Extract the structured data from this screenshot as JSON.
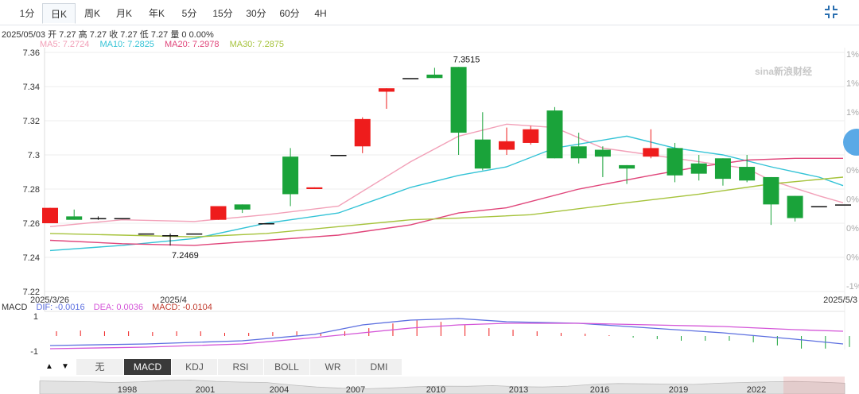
{
  "tabs": [
    "1分",
    "日K",
    "周K",
    "月K",
    "年K",
    "5分",
    "15分",
    "30分",
    "60分",
    "4H"
  ],
  "active_tab": "日K",
  "info": {
    "date": "2025/05/03",
    "open_label": "开",
    "open": "7.27",
    "high_label": "高",
    "high": "7.27",
    "close_label": "收",
    "close": "7.27",
    "low_label": "低",
    "low": "7.27",
    "volume_label": "量",
    "volume": "0",
    "change": "0.00%"
  },
  "ma_legend": [
    {
      "label": "MA5: 7.2724",
      "color": "#f2a0b8"
    },
    {
      "label": "MA10: 7.2825",
      "color": "#33c3d6"
    },
    {
      "label": "MA20: 7.2978",
      "color": "#e0457a"
    },
    {
      "label": "MA30: 7.2875",
      "color": "#a6c33c"
    }
  ],
  "watermark": "sina新浪财经",
  "macd_legend": {
    "title": "MACD",
    "dif": "DIF: -0.0016",
    "dif_color": "#5c6fe0",
    "dea": "DEA: 0.0036",
    "dea_color": "#d455d8",
    "macd": "MACD: -0.0104",
    "macd_color": "#c0392b"
  },
  "indicator_tabs": [
    "无",
    "MACD",
    "KDJ",
    "RSI",
    "BOLL",
    "WR",
    "DMI"
  ],
  "active_indicator": "MACD",
  "up_arrow": "▲",
  "down_arrow": "▼",
  "colors": {
    "up": "#ee1c1c",
    "down": "#1aa33a",
    "grid": "#eeeeee"
  },
  "chart_data": {
    "type": "candlestick",
    "x_labels": [
      "2025/3/26",
      "2025/4",
      "2025/5/3"
    ],
    "y_ticks": [
      "7.36",
      "7.34",
      "7.32",
      "7.3",
      "7.28",
      "7.26",
      "7.24",
      "7.22"
    ],
    "ylim": [
      7.22,
      7.36
    ],
    "right_ticks": [
      "1%",
      "1%",
      "1%",
      "1%",
      "0%",
      "0%",
      "0%",
      "0%",
      "-1%"
    ],
    "annotations": [
      {
        "label": "7.3515",
        "value": 7.3515,
        "candle": 17
      },
      {
        "label": "7.2469",
        "value": 7.2469,
        "candle": 5
      }
    ],
    "candles": [
      {
        "o": 7.26,
        "h": 7.269,
        "l": 7.26,
        "c": 7.269
      },
      {
        "o": 7.264,
        "h": 7.268,
        "l": 7.262,
        "c": 7.262
      },
      {
        "o": 7.263,
        "h": 7.264,
        "l": 7.262,
        "c": 7.263
      },
      {
        "o": 7.263,
        "h": 7.263,
        "l": 7.263,
        "c": 7.263
      },
      {
        "o": 7.254,
        "h": 7.254,
        "l": 7.254,
        "c": 7.254
      },
      {
        "o": 7.253,
        "h": 7.254,
        "l": 7.2469,
        "c": 7.253
      },
      {
        "o": 7.254,
        "h": 7.254,
        "l": 7.254,
        "c": 7.254
      },
      {
        "o": 7.262,
        "h": 7.27,
        "l": 7.262,
        "c": 7.27
      },
      {
        "o": 7.271,
        "h": 7.271,
        "l": 7.266,
        "c": 7.268
      },
      {
        "o": 7.26,
        "h": 7.26,
        "l": 7.26,
        "c": 7.26
      },
      {
        "o": 7.299,
        "h": 7.304,
        "l": 7.27,
        "c": 7.277
      },
      {
        "o": 7.28,
        "h": 7.281,
        "l": 7.28,
        "c": 7.281
      },
      {
        "o": 7.3,
        "h": 7.3,
        "l": 7.3,
        "c": 7.3
      },
      {
        "o": 7.305,
        "h": 7.322,
        "l": 7.301,
        "c": 7.321
      },
      {
        "o": 7.337,
        "h": 7.339,
        "l": 7.327,
        "c": 7.339
      },
      {
        "o": 7.345,
        "h": 7.345,
        "l": 7.345,
        "c": 7.345
      },
      {
        "o": 7.347,
        "h": 7.351,
        "l": 7.345,
        "c": 7.345
      },
      {
        "o": 7.3515,
        "h": 7.3515,
        "l": 7.3,
        "c": 7.313
      },
      {
        "o": 7.309,
        "h": 7.325,
        "l": 7.291,
        "c": 7.292
      },
      {
        "o": 7.303,
        "h": 7.316,
        "l": 7.3,
        "c": 7.308
      },
      {
        "o": 7.307,
        "h": 7.317,
        "l": 7.306,
        "c": 7.315
      },
      {
        "o": 7.326,
        "h": 7.328,
        "l": 7.298,
        "c": 7.298
      },
      {
        "o": 7.305,
        "h": 7.313,
        "l": 7.295,
        "c": 7.298
      },
      {
        "o": 7.303,
        "h": 7.305,
        "l": 7.287,
        "c": 7.299
      },
      {
        "o": 7.294,
        "h": 7.294,
        "l": 7.283,
        "c": 7.292
      },
      {
        "o": 7.299,
        "h": 7.315,
        "l": 7.298,
        "c": 7.304
      },
      {
        "o": 7.304,
        "h": 7.307,
        "l": 7.284,
        "c": 7.288
      },
      {
        "o": 7.295,
        "h": 7.3,
        "l": 7.285,
        "c": 7.289
      },
      {
        "o": 7.298,
        "h": 7.298,
        "l": 7.282,
        "c": 7.286
      },
      {
        "o": 7.293,
        "h": 7.3,
        "l": 7.284,
        "c": 7.285
      },
      {
        "o": 7.287,
        "h": 7.287,
        "l": 7.259,
        "c": 7.271
      },
      {
        "o": 7.276,
        "h": 7.276,
        "l": 7.261,
        "c": 7.263
      },
      {
        "o": 7.27,
        "h": 7.27,
        "l": 7.27,
        "c": 7.27
      },
      {
        "o": 7.271,
        "h": 7.271,
        "l": 7.271,
        "c": 7.271
      }
    ],
    "ma_series": [
      {
        "name": "MA5",
        "color": "#f2a0b8",
        "points": [
          [
            0,
            7.258
          ],
          [
            3,
            7.262
          ],
          [
            6,
            7.261
          ],
          [
            9,
            7.265
          ],
          [
            12,
            7.27
          ],
          [
            15,
            7.296
          ],
          [
            17,
            7.311
          ],
          [
            19,
            7.318
          ],
          [
            21,
            7.316
          ],
          [
            23,
            7.304
          ],
          [
            25,
            7.3
          ],
          [
            27,
            7.296
          ],
          [
            29,
            7.292
          ],
          [
            30,
            7.285
          ],
          [
            32,
            7.276
          ],
          [
            33,
            7.272
          ]
        ]
      },
      {
        "name": "MA10",
        "color": "#33c3d6",
        "points": [
          [
            0,
            7.244
          ],
          [
            3,
            7.247
          ],
          [
            6,
            7.251
          ],
          [
            9,
            7.26
          ],
          [
            12,
            7.266
          ],
          [
            15,
            7.281
          ],
          [
            17,
            7.288
          ],
          [
            19,
            7.293
          ],
          [
            21,
            7.304
          ],
          [
            24,
            7.311
          ],
          [
            26,
            7.304
          ],
          [
            28,
            7.3
          ],
          [
            30,
            7.293
          ],
          [
            32,
            7.287
          ],
          [
            33,
            7.282
          ]
        ]
      },
      {
        "name": "MA20",
        "color": "#e0457a",
        "points": [
          [
            0,
            7.25
          ],
          [
            3,
            7.248
          ],
          [
            6,
            7.247
          ],
          [
            9,
            7.25
          ],
          [
            12,
            7.253
          ],
          [
            15,
            7.259
          ],
          [
            17,
            7.266
          ],
          [
            19,
            7.269
          ],
          [
            22,
            7.28
          ],
          [
            25,
            7.288
          ],
          [
            27,
            7.293
          ],
          [
            29,
            7.297
          ],
          [
            31,
            7.298
          ],
          [
            33,
            7.298
          ]
        ]
      },
      {
        "name": "MA30",
        "color": "#a6c33c",
        "points": [
          [
            0,
            7.254
          ],
          [
            3,
            7.253
          ],
          [
            6,
            7.252
          ],
          [
            9,
            7.254
          ],
          [
            12,
            7.258
          ],
          [
            15,
            7.262
          ],
          [
            17,
            7.263
          ],
          [
            20,
            7.265
          ],
          [
            24,
            7.272
          ],
          [
            27,
            7.277
          ],
          [
            30,
            7.283
          ],
          [
            33,
            7.287
          ]
        ]
      }
    ],
    "macd": {
      "yticks": [
        "1",
        "-1"
      ],
      "dif_points": [
        [
          0,
          -0.6
        ],
        [
          4,
          -0.5
        ],
        [
          8,
          -0.3
        ],
        [
          11,
          0.1
        ],
        [
          13,
          0.7
        ],
        [
          15,
          1.0
        ],
        [
          17,
          1.1
        ],
        [
          19,
          0.9
        ],
        [
          22,
          0.8
        ],
        [
          25,
          0.5
        ],
        [
          28,
          0.2
        ],
        [
          31,
          -0.2
        ],
        [
          33,
          -0.5
        ]
      ],
      "dea_points": [
        [
          0,
          -0.8
        ],
        [
          4,
          -0.7
        ],
        [
          8,
          -0.5
        ],
        [
          11,
          -0.1
        ],
        [
          13,
          0.2
        ],
        [
          15,
          0.5
        ],
        [
          17,
          0.7
        ],
        [
          19,
          0.8
        ],
        [
          22,
          0.8
        ],
        [
          25,
          0.7
        ],
        [
          28,
          0.6
        ],
        [
          31,
          0.4
        ],
        [
          33,
          0.3
        ]
      ],
      "hist": [
        0.3,
        0.35,
        0.3,
        0.3,
        0.25,
        0.3,
        0.3,
        0.2,
        0.2,
        0.25,
        0.3,
        0.2,
        0.3,
        0.5,
        0.8,
        1.0,
        0.9,
        0.7,
        0.5,
        0.4,
        0.3,
        0.2,
        0.15,
        0.05,
        -0.1,
        -0.2,
        -0.3,
        -0.3,
        -0.3,
        -0.4,
        -0.6,
        -0.8,
        -0.8,
        -0.7
      ]
    },
    "overview_x_labels": [
      "1998",
      "2001",
      "2004",
      "2007",
      "2010",
      "2013",
      "2016",
      "2019",
      "2022"
    ],
    "overview_values": [
      0.75,
      0.72,
      0.7,
      0.66,
      0.7,
      0.78,
      0.8,
      0.72,
      0.68,
      0.66,
      0.52,
      0.4,
      0.33,
      0.3,
      0.35,
      0.42,
      0.45,
      0.44,
      0.48,
      0.42,
      0.4,
      0.45,
      0.55,
      0.6,
      0.58,
      0.57,
      0.55,
      0.62,
      0.66,
      0.7,
      0.72,
      0.68,
      0.62
    ]
  }
}
